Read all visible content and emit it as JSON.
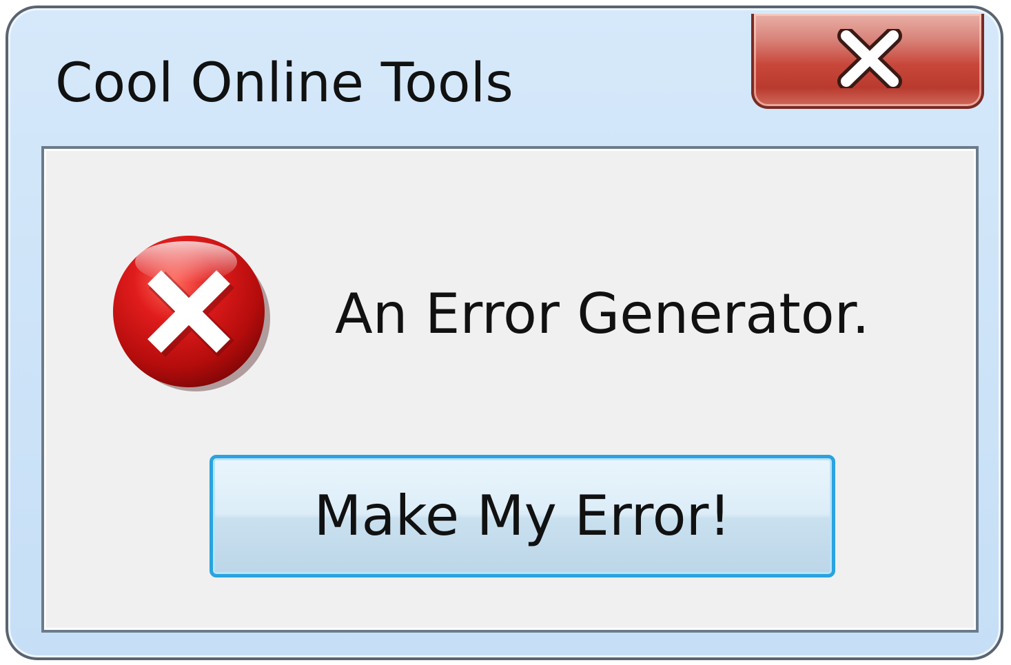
{
  "window": {
    "title": "Cool Online Tools",
    "close_icon": "close-x-icon",
    "close_color": "#c8473a"
  },
  "dialog": {
    "icon": "error-icon",
    "icon_color": "#cc1111",
    "message": "An Error Generator.",
    "button_label": "Make My Error!",
    "button_focus_color": "#2aa3e0"
  }
}
